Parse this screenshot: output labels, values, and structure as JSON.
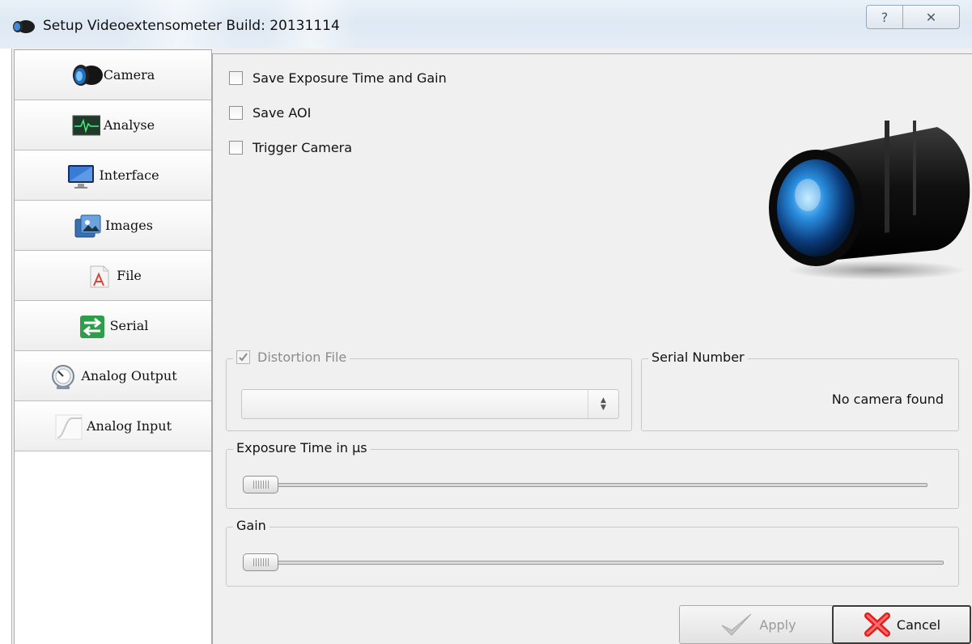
{
  "window": {
    "title": "Setup Videoextensometer Build: 20131114",
    "help_glyph": "?",
    "close_glyph": "✕"
  },
  "sidebar": {
    "items": [
      {
        "label": "Camera",
        "icon": "camera-lens-icon"
      },
      {
        "label": "Analyse",
        "icon": "monitor-waveform-icon"
      },
      {
        "label": "Interface",
        "icon": "desktop-monitor-icon"
      },
      {
        "label": "Images",
        "icon": "photos-icon"
      },
      {
        "label": "File",
        "icon": "file-document-icon"
      },
      {
        "label": "Serial",
        "icon": "serial-arrows-icon"
      },
      {
        "label": "Analog Output",
        "icon": "gauge-icon"
      },
      {
        "label": "Analog Input",
        "icon": "signal-curve-icon"
      }
    ]
  },
  "camera": {
    "checkboxes": [
      {
        "label": "Save Exposure Time and Gain",
        "checked": false
      },
      {
        "label": "Save AOI",
        "checked": false
      },
      {
        "label": "Trigger Camera",
        "checked": false
      }
    ],
    "distortion": {
      "label": "Distortion File",
      "checked": true,
      "enabled": false,
      "value": ""
    },
    "serial": {
      "title": "Serial Number",
      "value": "No camera found"
    },
    "exposure": {
      "title": "Exposure Time in µs",
      "value": 0
    },
    "gain": {
      "title": "Gain",
      "value": 0
    }
  },
  "footer": {
    "apply_label": "Apply",
    "cancel_label": "Cancel"
  },
  "colors": {
    "cancel_icon": "#e02020",
    "apply_icon_disabled": "#b9b9b9"
  }
}
